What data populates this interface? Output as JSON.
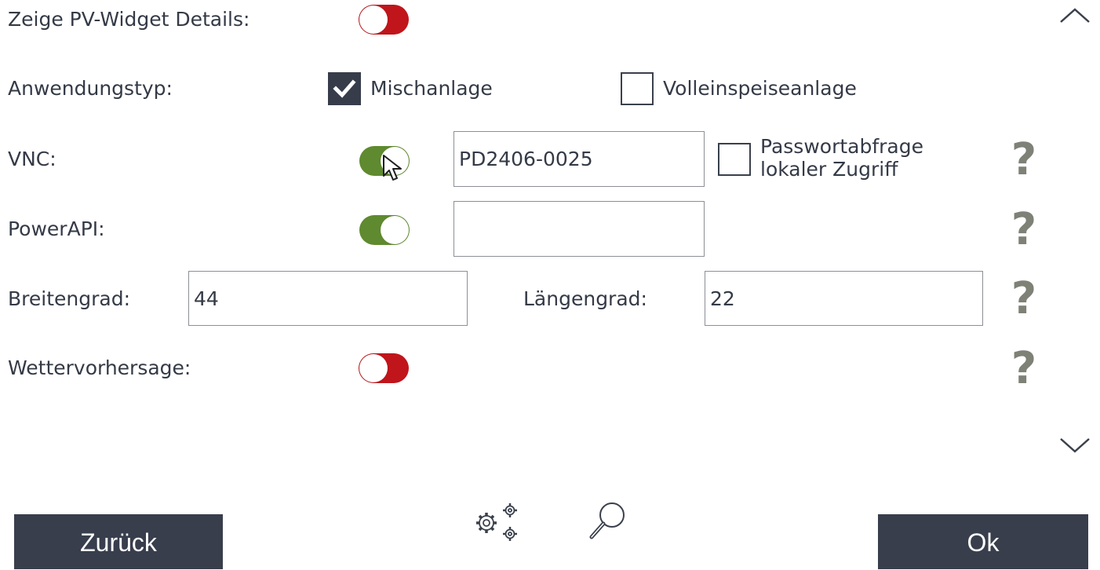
{
  "rows": {
    "pv_widget": {
      "label": "Zeige PV-Widget Details:",
      "enabled": false
    },
    "app_type": {
      "label": "Anwendungstyp:",
      "options": [
        {
          "label": "Mischanlage",
          "checked": true
        },
        {
          "label": "Volleinspeiseanlage",
          "checked": false
        }
      ]
    },
    "vnc": {
      "label": "VNC:",
      "enabled": true,
      "value": "PD2406-0025",
      "password_label_line1": "Passwortabfrage",
      "password_label_line2": "lokaler Zugriff",
      "password_checked": false
    },
    "powerapi": {
      "label": "PowerAPI:",
      "enabled": true,
      "value": ""
    },
    "location": {
      "lat_label": "Breitengrad:",
      "lat_value": "44",
      "lon_label": "Längengrad:",
      "lon_value": "22"
    },
    "weather": {
      "label": "Wettervorhersage:",
      "enabled": false
    }
  },
  "help_glyph": "?",
  "buttons": {
    "back": "Zurück",
    "ok": "Ok"
  },
  "icons": {
    "scroll_up": "chevron-up-icon",
    "scroll_down": "chevron-down-icon",
    "settings": "gears-icon",
    "search": "magnifier-icon",
    "cursor": "mouse-pointer-icon"
  },
  "colors": {
    "toggle_on": "#5f8a2f",
    "toggle_off": "#c0151b",
    "button_bg": "#383e4c",
    "help_icon": "#7e8176"
  }
}
